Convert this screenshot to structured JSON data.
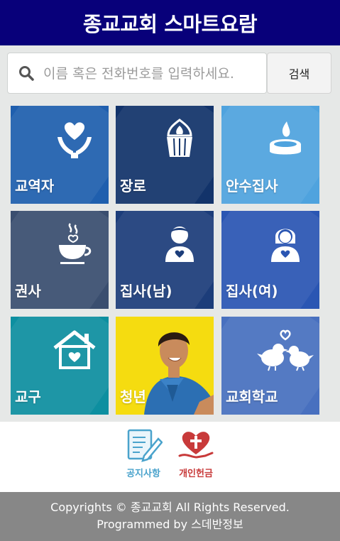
{
  "header": {
    "title": "종교교회 스마트요람"
  },
  "search": {
    "placeholder": "이름 혹은 전화번호를 입력하세요.",
    "button_label": "검색"
  },
  "tiles": [
    {
      "label": "교역자",
      "color": "#1f5fae",
      "icon": "heart-hands-icon"
    },
    {
      "label": "장로",
      "color": "#12336a",
      "icon": "cupcake-icon"
    },
    {
      "label": "안수집사",
      "color": "#4fa3de",
      "icon": "candle-icon"
    },
    {
      "label": "권사",
      "color": "#3a4e6f",
      "icon": "coffee-cup-icon"
    },
    {
      "label": "집사(남)",
      "color": "#1c3d7a",
      "icon": "man-heart-icon"
    },
    {
      "label": "집사(여)",
      "color": "#2a56b3",
      "icon": "woman-heart-icon"
    },
    {
      "label": "교구",
      "color": "#0d8fa0",
      "icon": "house-heart-icon"
    },
    {
      "label": "청년",
      "color": "#f5dc10",
      "icon": "young-man-photo"
    },
    {
      "label": "교회학교",
      "color": "#4870bf",
      "icon": "birds-heart-icon"
    }
  ],
  "quick_links": [
    {
      "label": "공지사항",
      "color": "#4aa3cc",
      "icon": "notepad-pencil-icon"
    },
    {
      "label": "개인헌금",
      "color": "#c83a3a",
      "icon": "heart-cross-hand-icon"
    }
  ],
  "footer": {
    "line1": "Copyrights © 종교교회 All Rights Reserved.",
    "line2": "Programmed by 스데반정보"
  }
}
